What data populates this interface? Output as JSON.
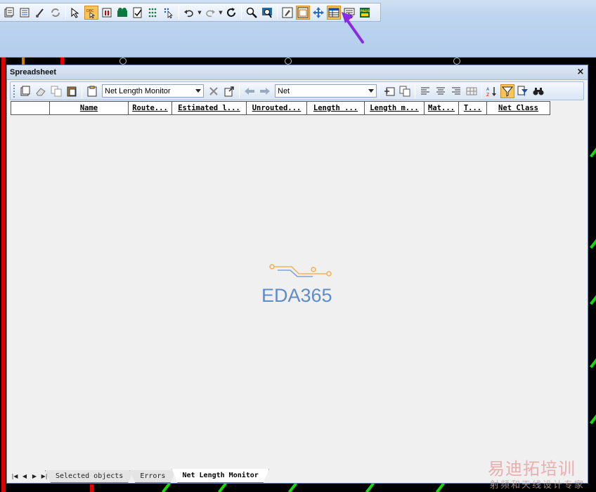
{
  "toolbar": {
    "icons": [
      "properties-icon",
      "list-icon",
      "brush-icon",
      "refresh-icon",
      "select-icon",
      "drc-icon",
      "component-icon",
      "route-icon",
      "checklist-icon",
      "dots-icon",
      "cursor-filter-icon",
      "undo-icon",
      "redo-icon",
      "rotate-icon",
      "zoom-icon",
      "zoom-window-icon",
      "pcb-edit-icon",
      "window-icon",
      "move-icon",
      "spreadsheet-icon",
      "report-icon",
      "pads-icon"
    ],
    "drc_label": "DRC",
    "pads_label": "PADS"
  },
  "spreadsheet": {
    "title": "Spreadsheet",
    "close_glyph": "×",
    "view_combo": "Net Length Monitor",
    "type_combo": "Net",
    "columns": [
      "",
      "Name",
      "Route...",
      "Estimated l...",
      "Unrouted...",
      "Length ...",
      "Length m...",
      "Mat...",
      "T...",
      "Net Class"
    ],
    "tabs": [
      "Selected objects",
      "Errors",
      "Net Length Monitor"
    ],
    "active_tab": "Net Length Monitor"
  },
  "watermark": {
    "text": "EDA365",
    "corner_line1": "易迪拓培训",
    "corner_line2": "射频和天线设计专家"
  },
  "colors": {
    "accent_orange": "#f7c55a",
    "pointer_purple": "#8a2be2",
    "trace_green": "#19d60e",
    "pcb_red": "#e00000"
  }
}
